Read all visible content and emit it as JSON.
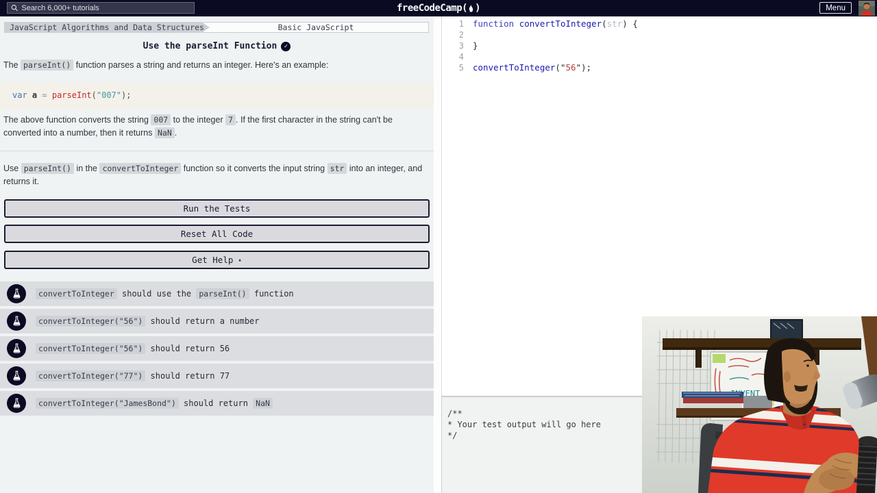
{
  "topbar": {
    "search_placeholder": "Search 6,000+ tutorials",
    "brand_name": "freeCodeCamp",
    "brand_open": "(",
    "brand_close": ")",
    "menu_label": "Menu"
  },
  "breadcrumb": {
    "superblock": "JavaScript Algorithms and Data Structures",
    "block": "Basic JavaScript"
  },
  "challenge": {
    "title": "Use the parseInt Function",
    "completed_check": "✓",
    "intro_segments": [
      {
        "t": "The "
      },
      {
        "c": "parseInt()"
      },
      {
        "t": " function parses a string and returns an integer. Here's an example:"
      }
    ],
    "example_code_tokens": [
      {
        "s": "var",
        "cls": "kw2"
      },
      {
        "s": " ",
        "cls": "pun2"
      },
      {
        "s": "a",
        "cls": "varb"
      },
      {
        "s": " = ",
        "cls": "op"
      },
      {
        "s": "parseInt",
        "cls": "fn2"
      },
      {
        "s": "(",
        "cls": "pun2"
      },
      {
        "s": "\"007\"",
        "cls": "str2"
      },
      {
        "s": ")",
        "cls": "pun2"
      },
      {
        "s": ";",
        "cls": "pun2"
      }
    ],
    "explain_segments": [
      {
        "t": "The above function converts the string "
      },
      {
        "c": "007"
      },
      {
        "t": " to the integer "
      },
      {
        "c": "7"
      },
      {
        "t": ". If the first character in the string can't be converted into a number, then it returns "
      },
      {
        "c": "NaN"
      },
      {
        "t": "."
      }
    ],
    "task_segments": [
      {
        "t": "Use "
      },
      {
        "c": "parseInt()"
      },
      {
        "t": " in the "
      },
      {
        "c": "convertToInteger"
      },
      {
        "t": " function so it converts the input string "
      },
      {
        "c": "str"
      },
      {
        "t": " into an integer, and returns it."
      }
    ]
  },
  "actions": {
    "run_label": "Run the Tests",
    "reset_label": "Reset All Code",
    "help_label": "Get Help",
    "help_caret": "▴"
  },
  "tests": [
    {
      "segments": [
        {
          "c": "convertToInteger"
        },
        {
          "t": " should use the "
        },
        {
          "c": "parseInt()"
        },
        {
          "t": " function"
        }
      ]
    },
    {
      "segments": [
        {
          "c": "convertToInteger(\"56\")"
        },
        {
          "t": " should return a number"
        }
      ]
    },
    {
      "segments": [
        {
          "c": "convertToInteger(\"56\")"
        },
        {
          "t": " should return 56"
        }
      ]
    },
    {
      "segments": [
        {
          "c": "convertToInteger(\"77\")"
        },
        {
          "t": " should return 77"
        }
      ]
    },
    {
      "segments": [
        {
          "c": "convertToInteger(\"JamesBond\")"
        },
        {
          "t": " should return "
        },
        {
          "c": "NaN"
        }
      ]
    }
  ],
  "editor": {
    "lines": [
      {
        "num": "1",
        "tokens": [
          {
            "s": "function ",
            "cls": "kw"
          },
          {
            "s": "convertToInteger",
            "cls": "fn"
          },
          {
            "s": "(",
            "cls": "pun"
          },
          {
            "s": "str",
            "cls": "param"
          },
          {
            "s": ") {",
            "cls": "pun"
          }
        ]
      },
      {
        "num": "2",
        "tokens": []
      },
      {
        "num": "3",
        "tokens": [
          {
            "s": "}",
            "cls": "pun"
          }
        ]
      },
      {
        "num": "4",
        "tokens": []
      },
      {
        "num": "5",
        "tokens": [
          {
            "s": "convertToInteger",
            "cls": "fn"
          },
          {
            "s": "(\"",
            "cls": "pun"
          },
          {
            "s": "56",
            "cls": "str"
          },
          {
            "s": "\");",
            "cls": "pun"
          }
        ]
      }
    ]
  },
  "output": {
    "lines": [
      "/**",
      "* Your test output will go here",
      "*/"
    ]
  },
  "colors": {
    "navbar": "#0a0a23",
    "accent_dark": "#1b1b32",
    "panel_bg": "#f0f3f4",
    "codeblock_bg": "#f4f1ea",
    "test_row_bg": "#dbdde1"
  }
}
